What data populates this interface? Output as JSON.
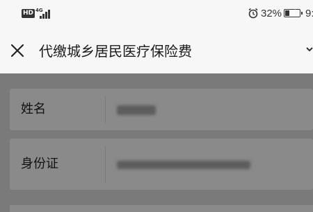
{
  "status_bar": {
    "hd_label": "HD",
    "network_type": "4G",
    "signal_icon": "signal-bars-icon",
    "alarm_icon": "alarm-clock-icon",
    "battery_percent": "32%",
    "battery_level": 0.32,
    "clock": "9:"
  },
  "header": {
    "close_icon": "close-icon",
    "title": "代缴城乡居民医疗保险费",
    "more_icon": "more-icon"
  },
  "form": {
    "fields": [
      {
        "label": "姓名",
        "value_obscured": true
      },
      {
        "label": "身份证",
        "value_obscured": true
      }
    ]
  },
  "colors": {
    "header_bg": "#f7f7f7",
    "overlay_bg": "#7a7a7a",
    "card_bg": "#8a8a8a"
  }
}
